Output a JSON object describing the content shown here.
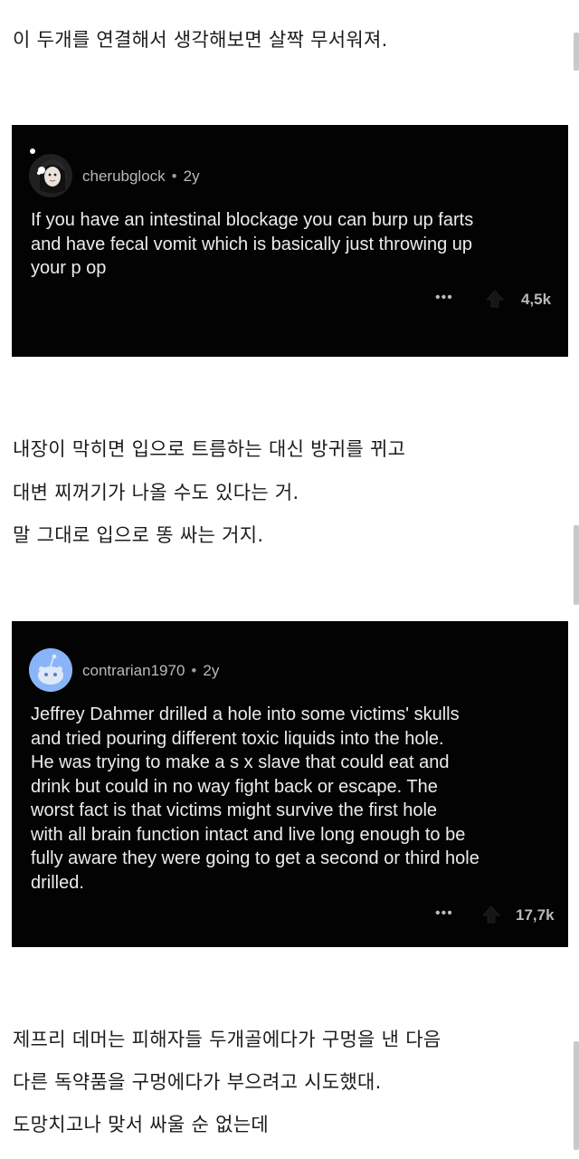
{
  "intro": {
    "line1": "이 두개를 연결해서 생각해보면 살짝 무서워져."
  },
  "comments": [
    {
      "username": "cherubglock",
      "separator": "•",
      "age": "2y",
      "body": "If you have an intestinal blockage you can burp up farts\nand have fecal vomit which is basically just throwing up\nyour p  op",
      "more_icon": "more-dots-icon",
      "vote_icon": "upvote-arrow-icon",
      "votes": "4,5k"
    },
    {
      "username": "contrarian1970",
      "separator": "•",
      "age": "2y",
      "body": "Jeffrey Dahmer drilled a hole into some victims' skulls\nand tried pouring different toxic liquids into the hole.\nHe was trying to make a s  x slave that could eat and\ndrink but could in no way fight back or escape.  The\nworst fact is that victims might survive the first hole\nwith all brain function intact and live long enough to be\nfully aware they were going to get a second or third hole\ndrilled.",
      "more_icon": "more-dots-icon",
      "vote_icon": "upvote-arrow-icon",
      "votes": "17,7k"
    }
  ],
  "explanation1": {
    "line1": "내장이 막히면 입으로 트름하는 대신 방귀를 뀌고",
    "line2": "대변 찌꺼기가 나올 수도 있다는 거.",
    "line3": "말 그대로 입으로 똥 싸는 거지."
  },
  "explanation2": {
    "line1": "제프리 데머는 피해자들 두개골에다가 구멍을 낸 다음",
    "line2": "다른 독약품을 구멍에다가 부으려고 시도했대.",
    "line3": "도망치고나 맞서 싸울 순 없는데"
  },
  "colors": {
    "card_background": "#030303",
    "comment_text": "#ececec",
    "meta_text": "#b9b9b9",
    "page_text": "#1c1c1c",
    "avatar2_blue": "#8ab4f8"
  }
}
